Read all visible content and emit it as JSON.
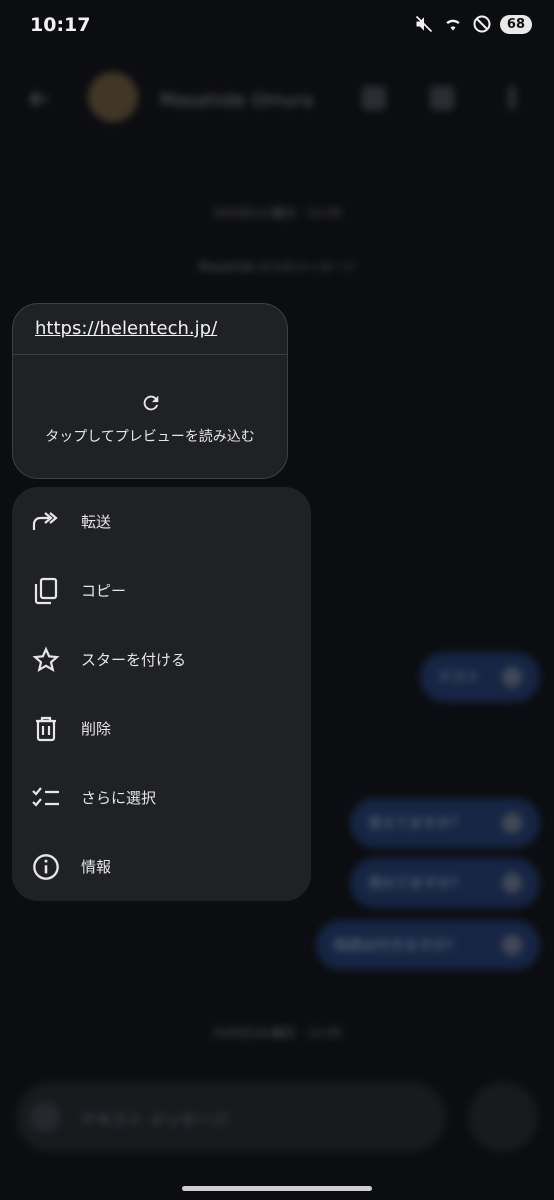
{
  "status": {
    "time": "10:17",
    "battery": "68"
  },
  "background": {
    "contact_name": "Masahide Omura",
    "date_sep_1": "10/5日(火)曜日 · 11:05",
    "date_sep_2": "10/6日(水)曜日 · 11:05",
    "sub_line": "Masahide からのメッセージ",
    "bubbles": [
      "テスト",
      "見えてますか？",
      "見れてますか？",
      "既読は付きますか？"
    ],
    "composer_placeholder": "テキスト メッセージ"
  },
  "message": {
    "url": "https://helentech.jp/",
    "preview_text": "タップしてプレビューを読み込む"
  },
  "menu": {
    "items": [
      {
        "label": "転送",
        "icon": "forward-icon"
      },
      {
        "label": "コピー",
        "icon": "copy-icon"
      },
      {
        "label": "スターを付ける",
        "icon": "star-icon"
      },
      {
        "label": "削除",
        "icon": "delete-icon"
      },
      {
        "label": "さらに選択",
        "icon": "select-more-icon"
      },
      {
        "label": "情報",
        "icon": "info-icon"
      }
    ]
  }
}
